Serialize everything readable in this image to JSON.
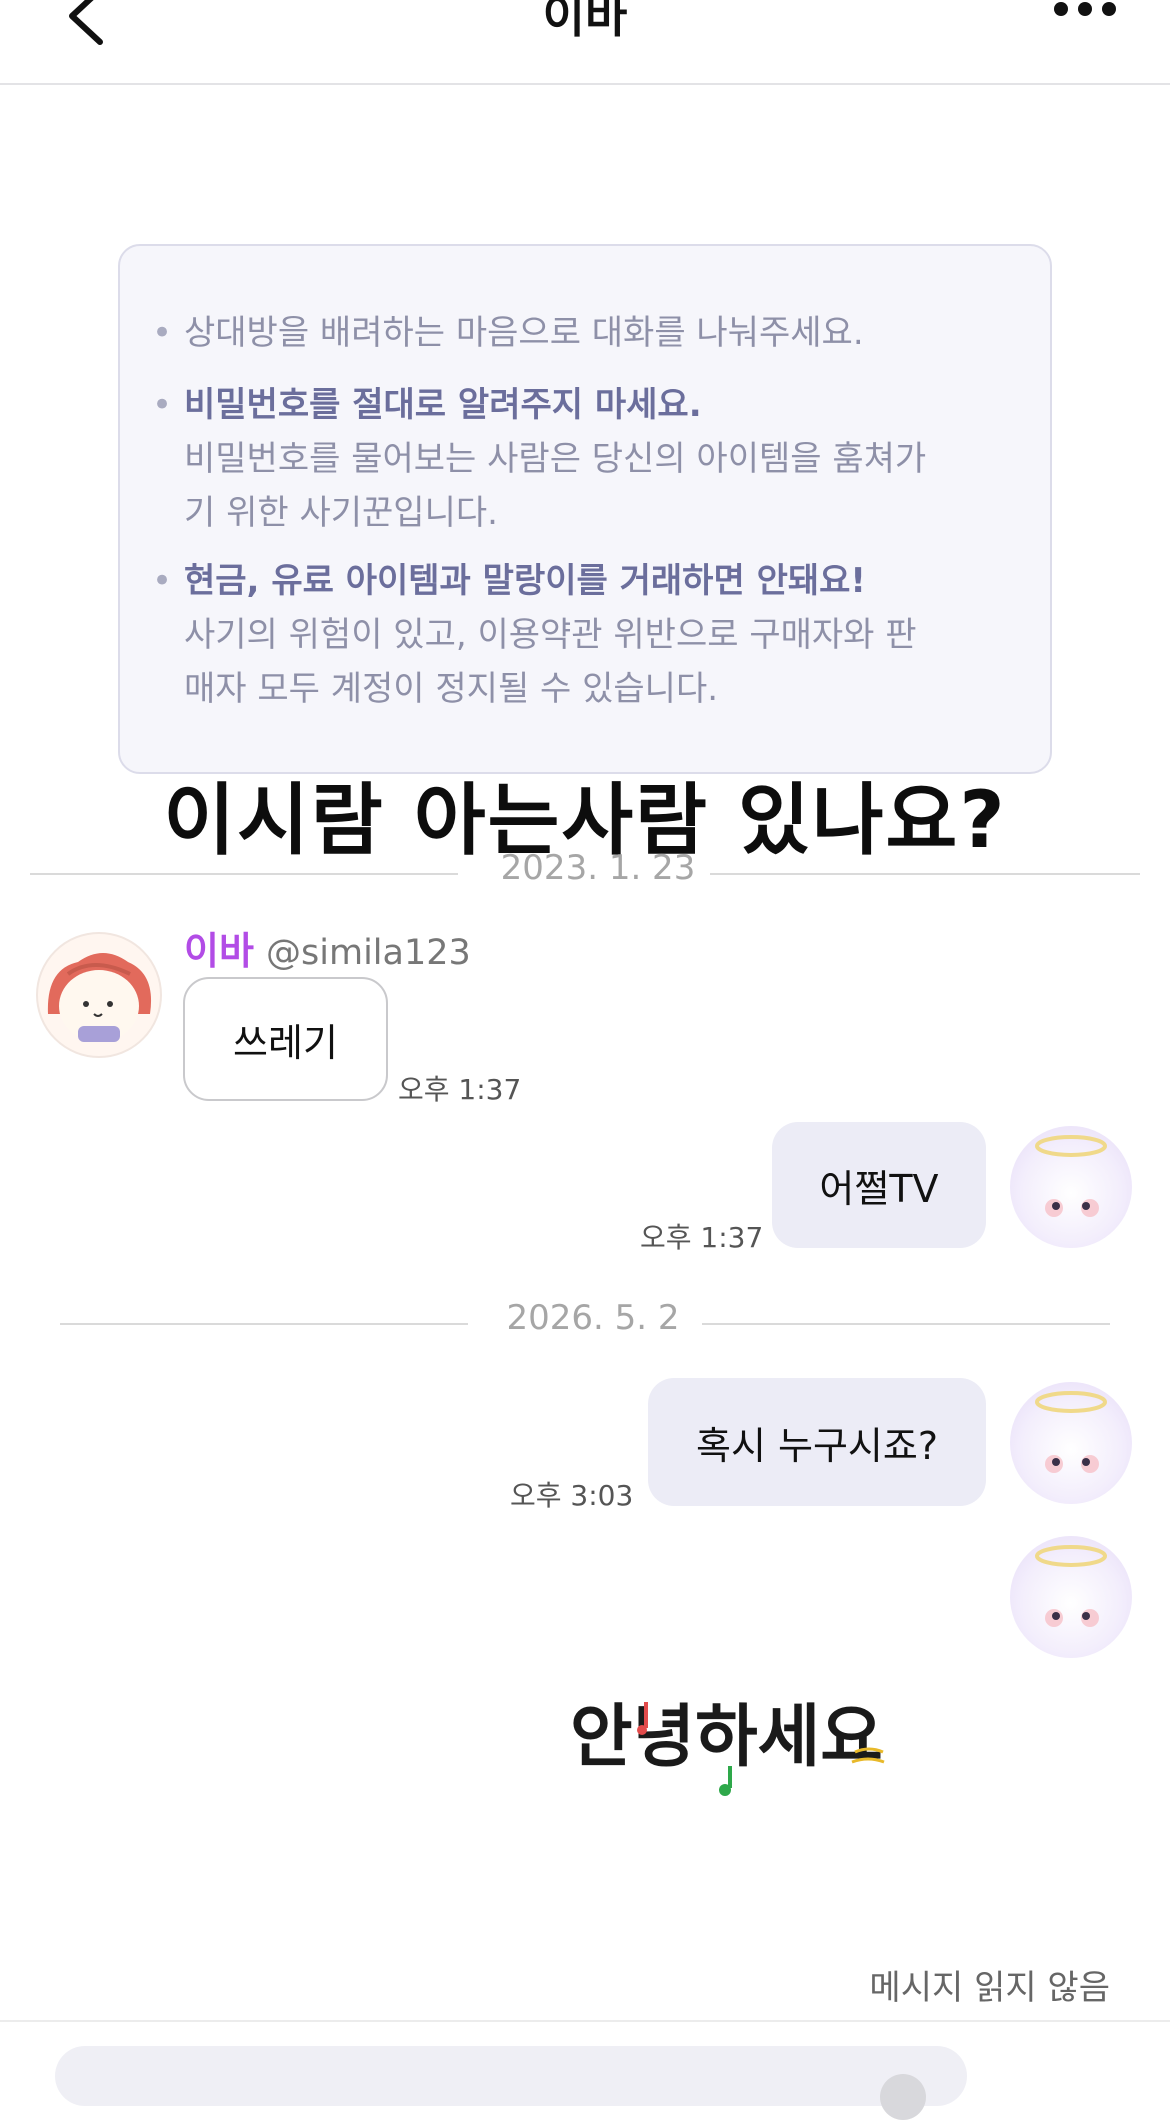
{
  "header": {
    "title": "이바",
    "back_icon": "chevron-left-icon",
    "more_icon": "more-horizontal-icon"
  },
  "notice": {
    "item1": "상대방을 배려하는 마음으로 대화를 나눠주세요.",
    "item2_title": "비밀번호를 절대로 알려주지 마세요.",
    "item2_line1": "비밀번호를 물어보는 사람은 당신의 아이템을 훔쳐가",
    "item2_line2": "기 위한 사기꾼입니다.",
    "item3_title": "현금, 유료 아이템과 말랑이를 거래하면 안돼요!",
    "item3_line1": "사기의 위험이 있고, 이용약관 위반으로 구매자와 판",
    "item3_line2": "매자 모두 계정이 정지될 수 있습니다.",
    "bullet": "•"
  },
  "caption": "이시람 아는사람 있나요?",
  "dividers": [
    "2023. 1. 23",
    "2026. 5. 2"
  ],
  "messages": [
    {
      "sender_name": "이바",
      "sender_handle": "@simila123",
      "text": "쓰레기",
      "time": "오후 1:37"
    },
    {
      "text": "어쩔TV",
      "time": "오후 1:37"
    },
    {
      "text": "혹시 누구시죠?",
      "time": "오후 3:03"
    }
  ],
  "sticker_text": "안녕하세요",
  "status": "메시지 읽지 않음",
  "colors": {
    "accent_name": "#b24ce6",
    "out_bubble": "#ececf6",
    "notice_bg": "#f6f6fb",
    "notice_strong": "#6b6e9c"
  }
}
